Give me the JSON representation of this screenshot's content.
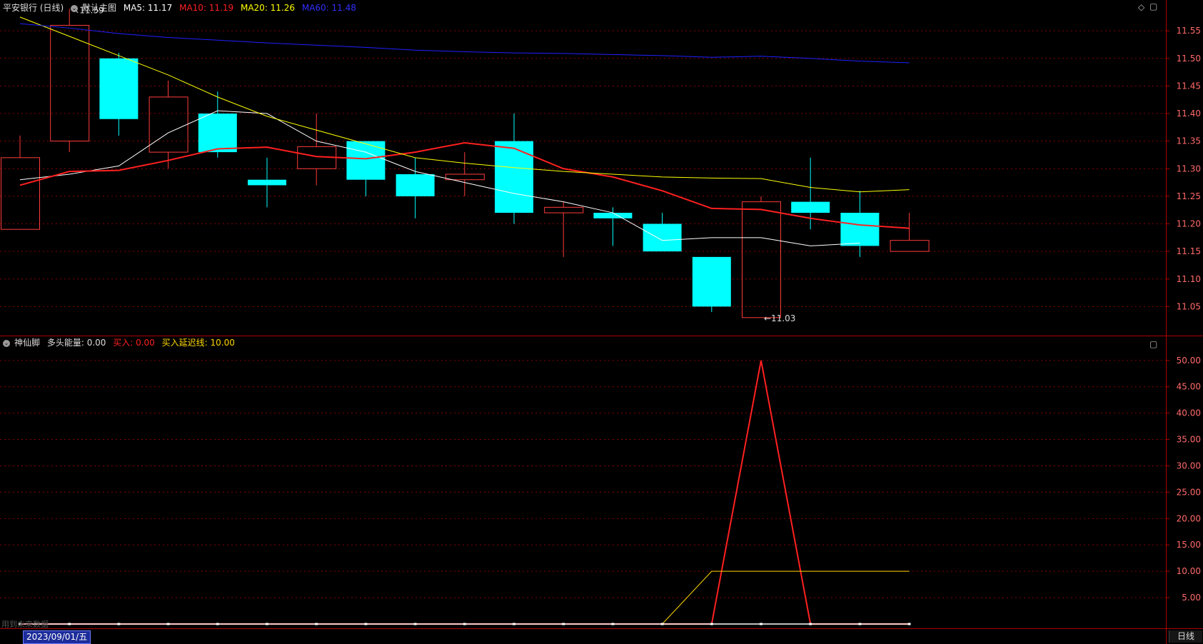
{
  "header_main": {
    "title": "平安银行 (日线)",
    "panel_name": "默认主图",
    "ma5": "MA5: 11.17",
    "ma10": "MA10: 11.19",
    "ma20": "MA20: 11.26",
    "ma60": "MA60: 11.48"
  },
  "header_sub": {
    "indicator": "神仙脚",
    "energy": "多头能量: 0.00",
    "buy": "买入: 0.00",
    "delay": "买入延迟线: 10.00"
  },
  "footer": {
    "date": "2023/09/01/五",
    "future_hint": "用到未来数据",
    "period": "日线"
  },
  "colors": {
    "up": "#ff3b3b",
    "down": "#00ffff",
    "ma5": "#ffffff",
    "ma10": "#ff2020",
    "ma20": "#ffff00",
    "ma60": "#2020ff",
    "grid": "#8b0000",
    "axis_text": "#ff6a6a",
    "label_normal": "#dddddd"
  },
  "icons": {
    "header_toggle": "circle-chevron-icon",
    "corner": "diamond-icon",
    "corner2": "square-icon"
  },
  "chart_data": [
    {
      "type": "candlestick",
      "title": "平安银行 (日线)",
      "ylim": [
        11.0,
        11.58
      ],
      "y_ticks": [
        "11.05",
        "11.10",
        "11.15",
        "11.20",
        "11.25",
        "11.30",
        "11.35",
        "11.40",
        "11.45",
        "11.50",
        "11.55"
      ],
      "candles": [
        {
          "o": 11.19,
          "h": 11.36,
          "l": 11.19,
          "c": 11.32
        },
        {
          "o": 11.35,
          "h": 11.59,
          "l": 11.33,
          "c": 11.56
        },
        {
          "o": 11.5,
          "h": 11.51,
          "l": 11.36,
          "c": 11.39
        },
        {
          "o": 11.33,
          "h": 11.46,
          "l": 11.3,
          "c": 11.43
        },
        {
          "o": 11.4,
          "h": 11.44,
          "l": 11.32,
          "c": 11.33
        },
        {
          "o": 11.28,
          "h": 11.32,
          "l": 11.23,
          "c": 11.27
        },
        {
          "o": 11.3,
          "h": 11.4,
          "l": 11.27,
          "c": 11.34
        },
        {
          "o": 11.35,
          "h": 11.35,
          "l": 11.25,
          "c": 11.28
        },
        {
          "o": 11.29,
          "h": 11.32,
          "l": 11.21,
          "c": 11.25
        },
        {
          "o": 11.28,
          "h": 11.33,
          "l": 11.25,
          "c": 11.29
        },
        {
          "o": 11.35,
          "h": 11.4,
          "l": 11.2,
          "c": 11.22
        },
        {
          "o": 11.22,
          "h": 11.24,
          "l": 11.14,
          "c": 11.23
        },
        {
          "o": 11.22,
          "h": 11.23,
          "l": 11.16,
          "c": 11.21
        },
        {
          "o": 11.2,
          "h": 11.22,
          "l": 11.15,
          "c": 11.15
        },
        {
          "o": 11.14,
          "h": 11.14,
          "l": 11.04,
          "c": 11.05
        },
        {
          "o": 11.03,
          "h": 11.25,
          "l": 11.03,
          "c": 11.24
        },
        {
          "o": 11.24,
          "h": 11.32,
          "l": 11.19,
          "c": 11.22
        },
        {
          "o": 11.22,
          "h": 11.26,
          "l": 11.14,
          "c": 11.16
        },
        {
          "o": 11.15,
          "h": 11.22,
          "l": 11.15,
          "c": 11.17
        }
      ],
      "series": [
        {
          "name": "MA5",
          "values": [
            11.28,
            11.29,
            11.305,
            11.365,
            11.405,
            11.4,
            11.35,
            11.33,
            11.295,
            11.275,
            11.255,
            11.24,
            11.22,
            11.17,
            11.175,
            11.175,
            11.16,
            11.165
          ]
        },
        {
          "name": "MA10",
          "values": [
            11.27,
            11.295,
            11.297,
            11.315,
            11.336,
            11.339,
            11.322,
            11.318,
            11.33,
            11.347,
            11.337,
            11.3,
            11.285,
            11.26,
            11.228,
            11.226,
            11.21,
            11.198,
            11.192
          ]
        },
        {
          "name": "MA20",
          "values": [
            11.575,
            11.54,
            11.505,
            11.47,
            11.43,
            11.395,
            11.37,
            11.345,
            11.32,
            11.31,
            11.302,
            11.295,
            11.29,
            11.285,
            11.283,
            11.282,
            11.266,
            11.258,
            11.262
          ]
        },
        {
          "name": "MA60",
          "values": [
            11.563,
            11.555,
            11.545,
            11.538,
            11.533,
            11.528,
            11.524,
            11.52,
            11.515,
            11.512,
            11.51,
            11.509,
            11.507,
            11.505,
            11.502,
            11.504,
            11.5,
            11.495,
            11.492
          ]
        }
      ],
      "annotations": [
        {
          "text": "11.59",
          "candle": 1,
          "value": 11.59
        },
        {
          "text": "11.03",
          "candle": 15,
          "value": 11.03
        }
      ]
    },
    {
      "type": "line",
      "title": "神仙脚",
      "ylim": [
        0,
        52
      ],
      "y_ticks": [
        "5.00",
        "10.00",
        "15.00",
        "20.00",
        "25.00",
        "30.00",
        "35.00",
        "40.00",
        "45.00",
        "50.00"
      ],
      "series": [
        {
          "name": "买入",
          "values": [
            0,
            0,
            0,
            0,
            0,
            0,
            0,
            0,
            0,
            0,
            0,
            0,
            0,
            0,
            0,
            50,
            0,
            0,
            0
          ]
        },
        {
          "name": "买入延迟线",
          "values": [
            0,
            0,
            0,
            0,
            0,
            0,
            0,
            0,
            0,
            0,
            0,
            0,
            0,
            0,
            10,
            10,
            10,
            10,
            10
          ]
        },
        {
          "name": "多头能量",
          "values": [
            0,
            0,
            0,
            0,
            0,
            0,
            0,
            0,
            0,
            0,
            0,
            0,
            0,
            0,
            0,
            0,
            0,
            0,
            0
          ]
        }
      ]
    }
  ]
}
